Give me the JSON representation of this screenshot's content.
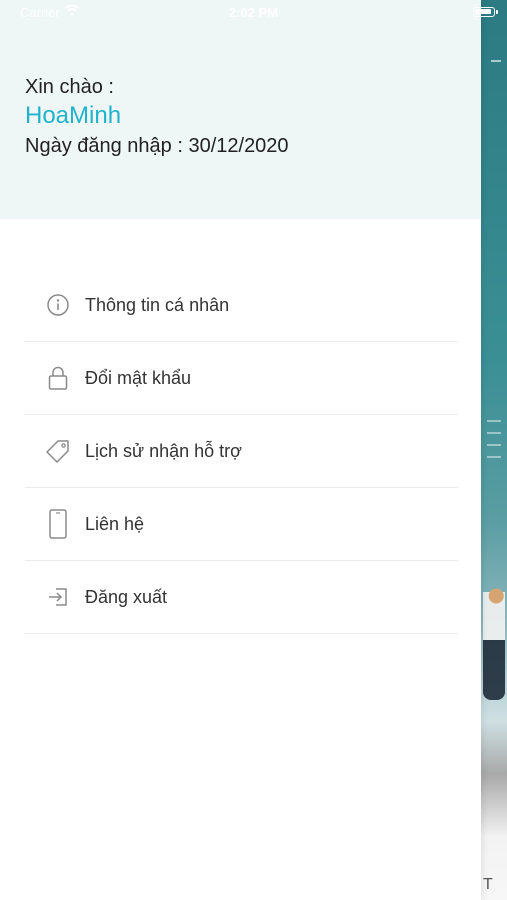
{
  "status_bar": {
    "carrier": "Carrier",
    "time": "2:02 PM"
  },
  "header": {
    "greeting": "Xin chào :",
    "username": "HoaMinh",
    "login_date": "Ngày đăng nhập : 30/12/2020"
  },
  "menu": {
    "items": [
      {
        "label": "Thông tin cá nhân",
        "icon": "info-icon"
      },
      {
        "label": "Đổi mật khẩu",
        "icon": "lock-icon"
      },
      {
        "label": "Lịch sử nhận hỗ trợ",
        "icon": "tag-icon"
      },
      {
        "label": "Liên hệ",
        "icon": "phone-icon"
      },
      {
        "label": "Đăng xuất",
        "icon": "logout-icon"
      }
    ]
  },
  "background_app": {
    "bottom_letter": "T"
  },
  "colors": {
    "accent": "#1fb3cc",
    "header_bg": "#eff6f6",
    "divider": "#ececec",
    "icon_gray": "#8a8a8a"
  }
}
